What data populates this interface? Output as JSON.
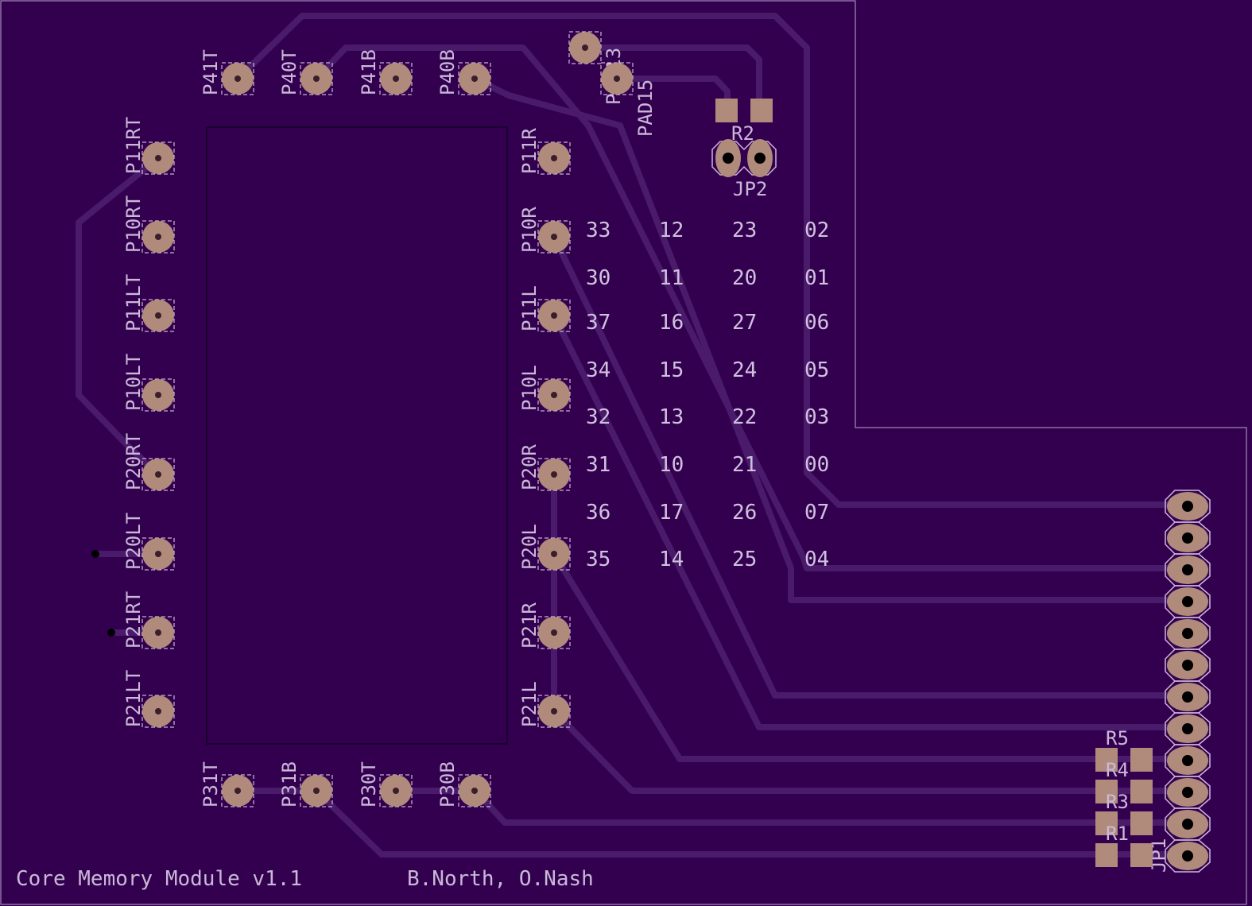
{
  "board": {
    "colors": {
      "background": "#33004f",
      "trace": "#4a1a6b",
      "pad": "#b08a7a",
      "silk": "#c9b8d8"
    }
  },
  "pads": {
    "top": [
      "P41T",
      "P40T",
      "P41B",
      "P40B"
    ],
    "bottom": [
      "P31T",
      "P31B",
      "P30T",
      "P30B"
    ],
    "left": [
      "P11RT",
      "P10RT",
      "P11LT",
      "P10LT",
      "P20RT",
      "P20LT",
      "P21RT",
      "P21LT"
    ],
    "right": [
      "P11R",
      "P10R",
      "P11L",
      "P10L",
      "P20R",
      "P20L",
      "P21R",
      "P21L"
    ]
  },
  "components": {
    "pad13": "PAD13",
    "pad15": "PAD15",
    "r2": "R2",
    "jp2": "JP2",
    "r5": "R5",
    "r4": "R4",
    "r3": "R3",
    "r1": "R1",
    "jp1": "JP1"
  },
  "address_grid": [
    [
      "33",
      "12",
      "23",
      "02"
    ],
    [
      "30",
      "11",
      "20",
      "01"
    ],
    [
      "37",
      "16",
      "27",
      "06"
    ],
    [
      "34",
      "15",
      "24",
      "05"
    ],
    [
      "32",
      "13",
      "22",
      "03"
    ],
    [
      "31",
      "10",
      "21",
      "00"
    ],
    [
      "36",
      "17",
      "26",
      "07"
    ],
    [
      "35",
      "14",
      "25",
      "04"
    ]
  ],
  "footer": {
    "title": "Core Memory Module v1.1",
    "authors": "B.North, O.Nash"
  }
}
